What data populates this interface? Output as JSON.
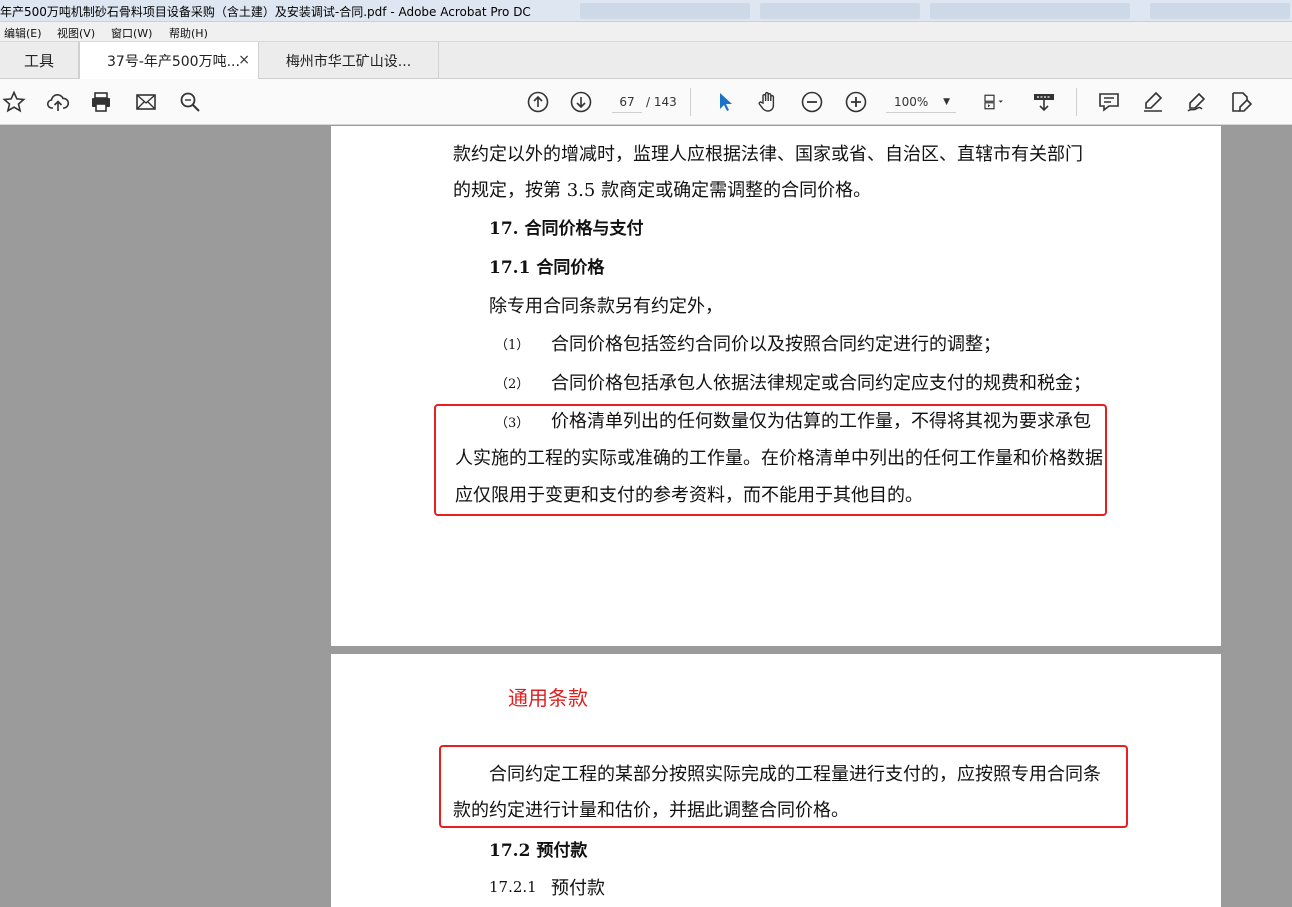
{
  "window": {
    "title": "年产500万吨机制砂石骨料项目设备采购（含土建）及安装调试-合同.pdf - Adobe Acrobat Pro DC"
  },
  "menu": {
    "items": [
      "编辑(E)",
      "视图(V)",
      "窗口(W)",
      "帮助(H)"
    ]
  },
  "tabs": [
    {
      "label": "工具"
    },
    {
      "label": "37号-年产500万吨...",
      "close": "×"
    },
    {
      "label": "梅州市华工矿山设..."
    }
  ],
  "toolbar": {
    "page_current": "67",
    "page_total": "/ 143",
    "zoom": "100%",
    "icons": [
      "star-icon",
      "cloud-upload-icon",
      "print-icon",
      "mail-icon",
      "search-icon",
      "page-up-icon",
      "page-down-icon",
      "select-cursor-icon",
      "hand-icon",
      "zoom-out-icon",
      "zoom-in-icon",
      "page-layout-icon",
      "scroll-mode-icon",
      "comment-icon",
      "highlight-icon",
      "sign-icon",
      "edit-icon"
    ]
  },
  "page1": {
    "line1": "款约定以外的增减时，监理人应根据法律、国家或省、自治区、直辖市有关部门",
    "line2": "的规定，按第 3.5 款商定或确定需调整的合同价格。",
    "heading17": "17.  合同价格与支付",
    "heading171": "17.1 合同价格",
    "intro": "除专用合同条款另有约定外，",
    "item1_num": "（1）",
    "item1_text": "合同价格包括签约合同价以及按照合同约定进行的调整；",
    "item2_num": "（2）",
    "item2_text": "合同价格包括承包人依据法律规定或合同约定应支付的规费和税金；",
    "item3_num": "（3）",
    "item3_text_a": "价格清单列出的任何数量仅为估算的工作量，不得将其视为要求承包",
    "item3_text_b": "人实施的工程的实际或准确的工作量。在价格清单中列出的任何工作量和价格数据",
    "item3_text_c": "应仅限用于变更和支付的参考资料，而不能用于其他目的。"
  },
  "page2": {
    "red_title": "通用条款",
    "para_a": "合同约定工程的某部分按照实际完成的工程量进行支付的，应按照专用合同条",
    "para_b": "款的约定进行计量和估价，并据此调整合同价格。",
    "heading172": "17.2 预付款",
    "sub_num": "17.2.1",
    "sub_text": "预付款"
  },
  "colors": {
    "highlight_box": "#e81f1f",
    "red_title": "#e02020",
    "viewer_bg": "#9b9b9b",
    "select_tool": "#1a73c9"
  }
}
